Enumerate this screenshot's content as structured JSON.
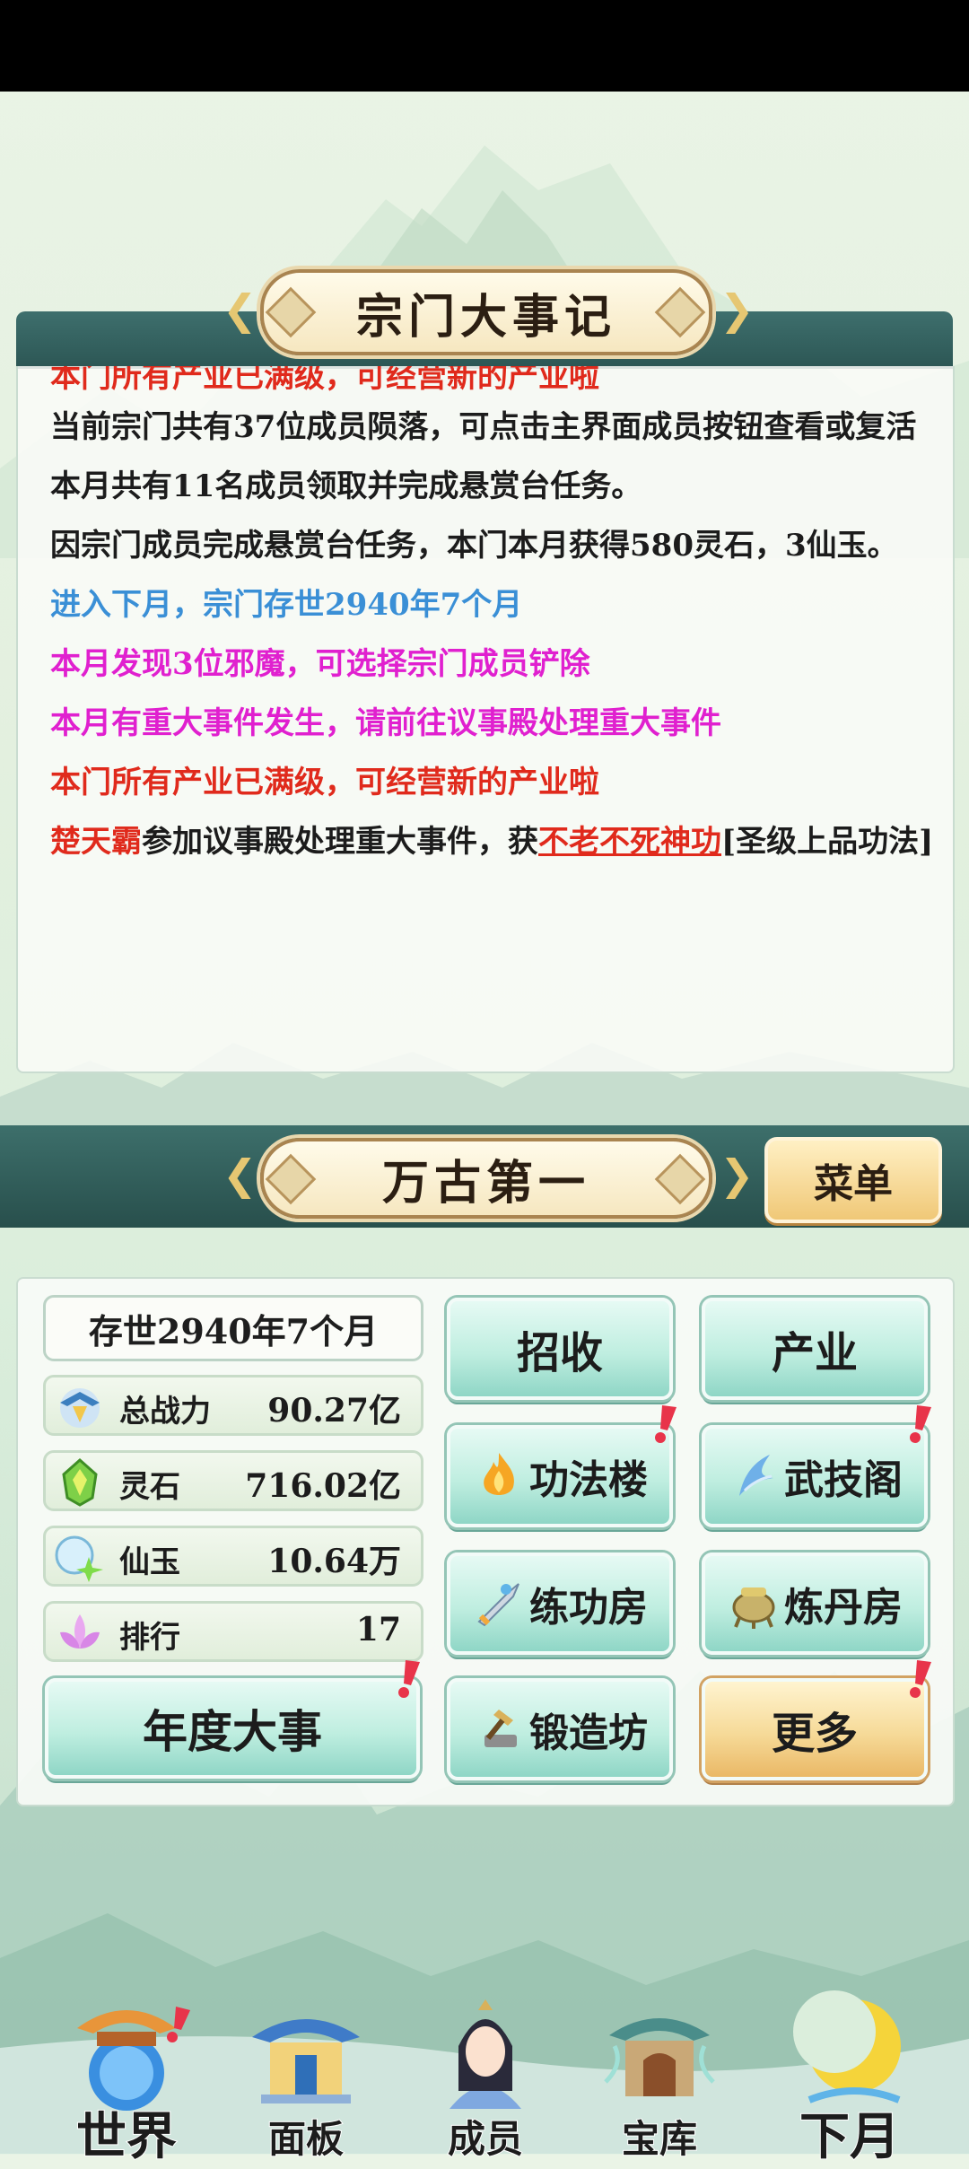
{
  "chronicle": {
    "title": "宗门大事记",
    "logs": [
      {
        "text": "本门所有产业已满级，可经营新的产业啦",
        "color": "red"
      },
      {
        "text": "当前宗门共有37位成员陨落，可点击主界面成员按钮查看或复活",
        "color": "black"
      },
      {
        "text": "本月共有11名成员领取并完成悬赏台任务。",
        "color": "black"
      },
      {
        "text": "因宗门成员完成悬赏台任务，本门本月获得580灵石，3仙玉。",
        "color": "black"
      },
      {
        "text": "进入下月，宗门存世2940年7个月",
        "color": "blue"
      },
      {
        "text": "本月发现3位邪魔，可选择宗门成员铲除",
        "color": "magenta"
      },
      {
        "text": "本月有重大事件发生，请前往议事殿处理重大事件",
        "color": "magenta"
      },
      {
        "text": "本门所有产业已满级，可经营新的产业啦",
        "color": "red"
      }
    ],
    "last_log": {
      "name": "楚天霸",
      "mid": "参加议事殿处理重大事件，获",
      "skill": "不老不死神功",
      "suffix": "[圣级上品功法]"
    }
  },
  "sect": {
    "name": "万古第一",
    "menu_label": "菜单"
  },
  "stats": {
    "age": "存世2940年7个月",
    "power": {
      "label": "总战力",
      "value": "90.27亿",
      "icon": "power-icon"
    },
    "spirit_stone": {
      "label": "灵石",
      "value": "716.02亿",
      "icon": "spirit-stone-icon"
    },
    "jade": {
      "label": "仙玉",
      "value": "10.64万",
      "icon": "jade-icon"
    },
    "rank": {
      "label": "排行",
      "value": "17",
      "icon": "lotus-icon"
    }
  },
  "buttons": {
    "annual": "年度大事",
    "recruit": "招收",
    "industry": "产业",
    "skill_tower": "功法楼",
    "martial_pavilion": "武技阁",
    "training_room": "练功房",
    "alchemy_room": "炼丹房",
    "forge": "锻造坊",
    "more": "更多"
  },
  "nav": {
    "world": "世界",
    "panel": "面板",
    "members": "成员",
    "treasury": "宝库",
    "next_month": "下月"
  },
  "colors": {
    "accent_teal": "#2c5654",
    "log_red": "#e02a1c",
    "log_blue": "#3a8fd6",
    "log_magenta": "#e020cf",
    "badge_red": "#e8344a"
  }
}
